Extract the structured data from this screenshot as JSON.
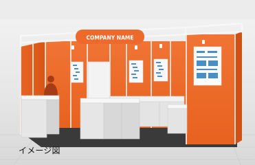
{
  "booth": {
    "sign_text": "COMPANY NAME",
    "caption": "イメージ図"
  },
  "colors": {
    "orange": "#ee6a2c",
    "orange_dark": "#d4561b",
    "frame": "#f2f2f2",
    "counter": "#dcdcdc",
    "floor": "#3a3a3a",
    "ground": "#cfcfcf"
  }
}
